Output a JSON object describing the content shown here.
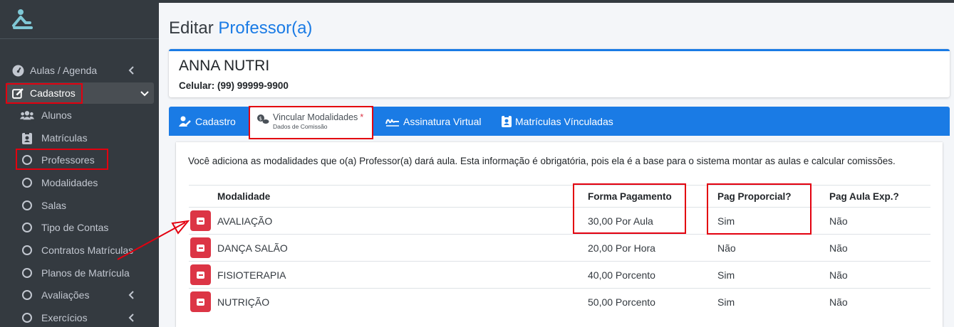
{
  "sidebar": {
    "items": [
      {
        "label": "Aulas / Agenda",
        "icon": "gauge-icon"
      },
      {
        "label": "Cadastros",
        "icon": "edit-icon"
      },
      {
        "label": "Alunos",
        "icon": "users-icon"
      },
      {
        "label": "Matrículas",
        "icon": "id-badge-icon"
      },
      {
        "label": "Professores",
        "icon": "circle-icon"
      },
      {
        "label": "Modalidades",
        "icon": "circle-icon"
      },
      {
        "label": "Salas",
        "icon": "circle-icon"
      },
      {
        "label": "Tipo de Contas",
        "icon": "circle-icon"
      },
      {
        "label": "Contratos Matrículas",
        "icon": "circle-icon"
      },
      {
        "label": "Planos de Matrícula",
        "icon": "circle-icon"
      },
      {
        "label": "Avaliações",
        "icon": "circle-icon"
      },
      {
        "label": "Exercícios",
        "icon": "circle-icon"
      }
    ]
  },
  "page": {
    "title_prefix": "Editar",
    "title_accent": "Professor(a)"
  },
  "professor": {
    "name": "ANNA NUTRI",
    "phone": "Celular: (99) 99999-9900"
  },
  "tabs": [
    {
      "label": "Cadastro",
      "icon": "user-edit-icon"
    },
    {
      "label": "Vincular Modalidades",
      "sublabel": "Dados de Comissão",
      "required": "*",
      "icon": "coins-icon"
    },
    {
      "label": "Assinatura Virtual",
      "icon": "signature-icon"
    },
    {
      "label": "Matrículas Vínculadas",
      "icon": "id-badge-icon"
    }
  ],
  "intro_text": "Você adiciona as modalidades que o(a) Professor(a) dará aula. Esta informação é obrigatória, pois ela é a base para o sistema montar as aulas e calcular comissões.",
  "table": {
    "columns": [
      "Modalidade",
      "Forma Pagamento",
      "Pag Proporcial?",
      "Pag Aula Exp.?"
    ],
    "rows": [
      {
        "modalidade": "AVALIAÇÃO",
        "forma": "30,00 Por Aula",
        "proporcional": "Sim",
        "exp": "Não"
      },
      {
        "modalidade": "DANÇA SALÃO",
        "forma": "20,00 Por Hora",
        "proporcional": "Não",
        "exp": "Não"
      },
      {
        "modalidade": "FISIOTERAPIA",
        "forma": "40,00 Porcento",
        "proporcional": "Sim",
        "exp": "Não"
      },
      {
        "modalidade": "NUTRIÇÃO",
        "forma": "50,00 Porcento",
        "proporcional": "Sim",
        "exp": "Não"
      }
    ]
  },
  "colors": {
    "primary": "#1a7be5",
    "sidebar": "#343a40",
    "danger": "#dc3545",
    "highlight": "#e3000f"
  }
}
